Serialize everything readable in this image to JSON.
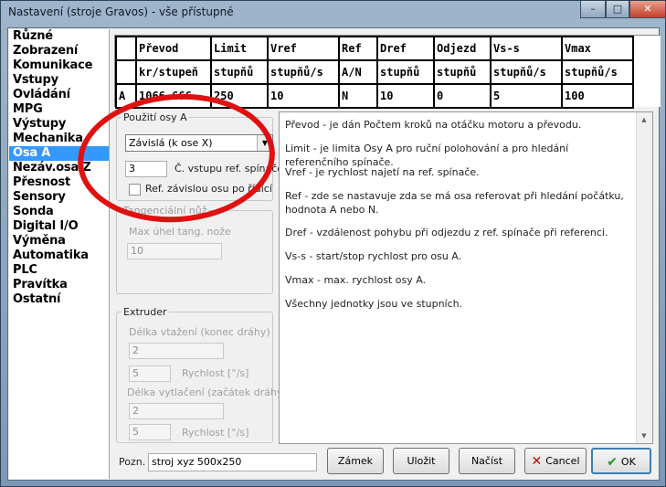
{
  "window": {
    "title": "Nastavení (stroje Gravos) - vše přístupné",
    "controls": {
      "minimize": "–",
      "maximize": "□",
      "close": "✕"
    }
  },
  "sidebar": {
    "items": [
      {
        "label": "Různé"
      },
      {
        "label": "Zobrazení"
      },
      {
        "label": "Komunikace"
      },
      {
        "label": "Vstupy"
      },
      {
        "label": "Ovládání"
      },
      {
        "label": "MPG"
      },
      {
        "label": "Výstupy"
      },
      {
        "label": "Mechanika"
      },
      {
        "label": "Osa A",
        "selected": true
      },
      {
        "label": "Nezáv.osa Z"
      },
      {
        "label": "Přesnost"
      },
      {
        "label": "Sensory"
      },
      {
        "label": "Sonda"
      },
      {
        "label": "Digital I/O"
      },
      {
        "label": "Výměna"
      },
      {
        "label": "Automatika"
      },
      {
        "label": "PLC"
      },
      {
        "label": "Pravítka"
      },
      {
        "label": "Ostatní"
      }
    ]
  },
  "grid": {
    "headers": [
      "Převod",
      "Limit",
      "Vref",
      "Ref",
      "Dref",
      "Odjezd",
      "Vs-s",
      "Vmax"
    ],
    "units": [
      "kr/stupeň",
      "stupňů",
      "stupňů/s",
      "A/N",
      "stupňů",
      "stupňů",
      "stupňů/s",
      "stupňů/s"
    ],
    "row_label": "A",
    "values": [
      "1066.666",
      "250",
      "10",
      "N",
      "10",
      "0",
      "5",
      "100"
    ]
  },
  "axis_use": {
    "legend": "Použití osy A",
    "mode": "Závislá (k ose X)",
    "input_number": "3",
    "input_label": "Č. vstupu ref. spínače",
    "checkbox_label": "Ref. závislou osu po řídící"
  },
  "tangential_knife": {
    "legend": "Tangenciální nůž",
    "max_angle_label": "Max úhel tang. nože",
    "max_angle_value": "10"
  },
  "extruder": {
    "legend": "Extruder",
    "retract_label": "Délka vtažení (konec dráhy)",
    "retract_value": "2",
    "retract_speed_value": "5",
    "retract_speed_label": "Rychlost [°/s]",
    "push_label": "Délka vytlačení (začátek dráhy)",
    "push_value": "2",
    "push_speed_value": "5",
    "push_speed_label": "Rychlost [°/s]"
  },
  "help": {
    "lines": [
      "Převod - je dán Počtem kroků na otáčku motoru a převodu.",
      "Limit - je limita Osy A  pro ruční polohování a pro hledání referenčního spínače.",
      "Vref - je rychlost najetí na ref. spínače.",
      "Ref - zde se nastavuje zda se má osa referovat při hledání počátku, hodnota A nebo N.",
      "Dref - vzdálenost pohybu při odjezdu z ref. spínače při referenci.",
      "Vs-s - start/stop rychlost pro osu A.",
      "Vmax - max. rychlost osy A.",
      "Všechny jednotky jsou ve stupních."
    ]
  },
  "bottom": {
    "note_label": "Pozn.",
    "note_value": "stroj xyz 500x250",
    "lock_label": "Zámek",
    "save_label": "Uložit",
    "load_label": "Načíst",
    "cancel_label": "Cancel",
    "ok_label": "OK"
  },
  "colors": {
    "selection": "#3399ff",
    "annotation": "#e01010",
    "cancel_icon": "#c00000",
    "ok_icon": "#1a9a1a"
  }
}
